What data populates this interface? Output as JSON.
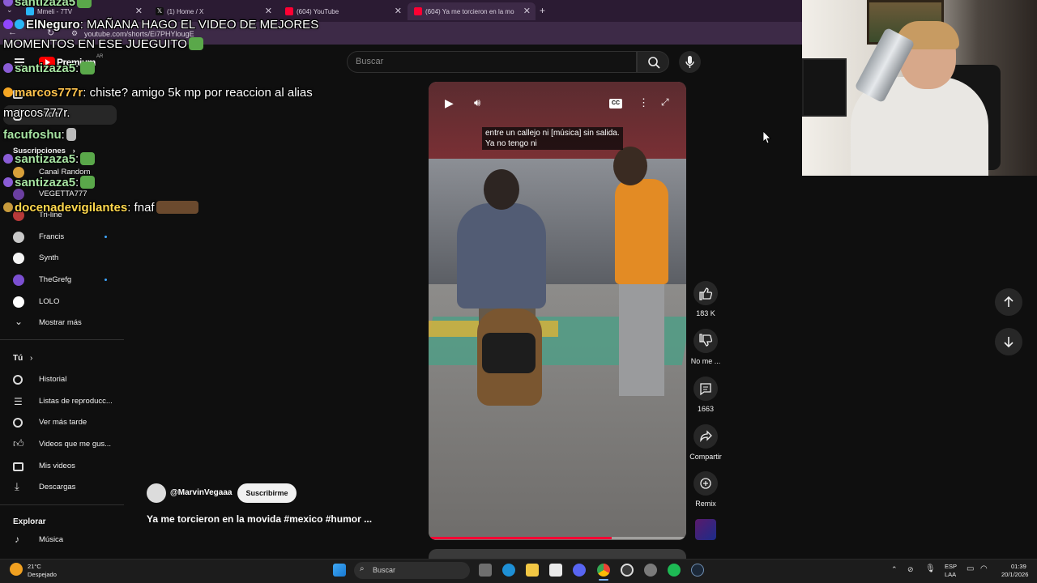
{
  "browser": {
    "tabs": [
      {
        "title": "Mmeli - 7TV",
        "color": "#29b6f6"
      },
      {
        "title": "(1) Home / X",
        "color": "#000000"
      },
      {
        "title": "(604) YouTube",
        "color": "#ff0033"
      },
      {
        "title": "(604) Ya me torcieron en la mo",
        "color": "#ff0033"
      }
    ],
    "new_tab": "+",
    "url": "youtube.com/shorts/Ei7PHYlougE"
  },
  "youtube": {
    "logo_text": "Premium",
    "logo_sup": "AR",
    "search_placeholder": "Buscar",
    "sidebar": {
      "top_items": [
        {
          "label": "Inicio"
        },
        {
          "label": "Shorts"
        }
      ],
      "subscriptions_header": "Suscripciones",
      "subscriptions": [
        {
          "label": "Canal Random",
          "avatar_color": "#d9a03a",
          "dot": false
        },
        {
          "label": "VEGETTA777",
          "avatar_color": "#6b3fa0",
          "dot": false
        },
        {
          "label": "Tri-line",
          "avatar_color": "#b83a3a",
          "dot": false
        },
        {
          "label": "Francis",
          "avatar_color": "#c9c9c9",
          "dot": true
        },
        {
          "label": "Synth",
          "avatar_color": "#f5f5f5",
          "dot": false
        },
        {
          "label": "TheGrefg",
          "avatar_color": "#7b4fd1",
          "dot": true
        },
        {
          "label": "LOLO",
          "avatar_color": "#ffffff",
          "dot": false
        }
      ],
      "show_more": "Mostrar más",
      "you_header": "Tú",
      "you_items": [
        {
          "label": "Historial",
          "icon": "history-icon"
        },
        {
          "label": "Listas de reproducc...",
          "icon": "playlist-icon"
        },
        {
          "label": "Ver más tarde",
          "icon": "watch-later-icon"
        },
        {
          "label": "Videos que me gus...",
          "icon": "like-icon"
        },
        {
          "label": "Mis videos",
          "icon": "my-videos-icon"
        },
        {
          "label": "Descargas",
          "icon": "download-icon"
        }
      ],
      "explore_header": "Explorar",
      "explore_items": [
        {
          "label": "Música",
          "icon": "music-icon"
        }
      ]
    },
    "short": {
      "captions": [
        "entre un callejo ni [música] sin salida.",
        "Ya no tengo ni"
      ],
      "cc_label": "CC",
      "progress_fraction": 0.71,
      "channel": "@MarvinVegaaa",
      "subscribe_label": "Suscribirme",
      "title": "Ya me torcieron en la movida  #mexico #humor ..."
    },
    "actions": {
      "likes": "183 K",
      "dislike_label": "No me ...",
      "comments": "1663",
      "share_label": "Compartir",
      "remix_label": "Remix"
    }
  },
  "chat": [
    {
      "user": "santizaza5",
      "text": "",
      "color": "#a6e3a1"
    },
    {
      "user": "ElNeguro",
      "text": ": MAÑANA HAGO EL VIDEO DE MEJORES",
      "color": "#f4f4f4"
    },
    {
      "user": "",
      "text": "MOMENTOS EN ESE JUEGUITO",
      "color": "#ffffff"
    },
    {
      "user": "santizaza5",
      "text": ":",
      "color": "#a6e3a1"
    },
    {
      "user": "marcos777r",
      "text": ": chiste? amigo 5k mp por reaccion al alias",
      "color": "#ffc34d"
    },
    {
      "user": "",
      "text": "marcos777r.",
      "color": "#ffffff"
    },
    {
      "user": "facufoshu",
      "text": ":",
      "color": "#a6e3a1"
    },
    {
      "user": "santizaza5",
      "text": ":",
      "color": "#a6e3a1"
    },
    {
      "user": "santizaza5",
      "text": ":",
      "color": "#a6e3a1"
    },
    {
      "user": "docenadevigilantes",
      "text": ": fnaf",
      "color": "#ffd84d"
    }
  ],
  "taskbar": {
    "weather_temp": "21°C",
    "weather_desc": "Despejado",
    "search_placeholder": "Buscar",
    "lang_top": "ESP",
    "lang_bottom": "LAA",
    "time": "01:39",
    "date": "20/1/2026"
  }
}
